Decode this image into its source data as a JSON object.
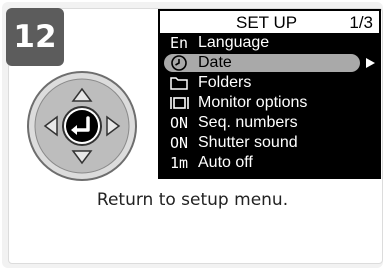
{
  "step": {
    "number": "12"
  },
  "menu": {
    "title": "SET UP",
    "page": "1/3",
    "items": [
      {
        "icon": "En",
        "label": "Language",
        "selected": false
      },
      {
        "icon": "clock",
        "label": "Date",
        "selected": true
      },
      {
        "icon": "folder",
        "label": "Folders",
        "selected": false
      },
      {
        "icon": "monitor",
        "label": "Monitor options",
        "selected": false
      },
      {
        "icon": "ON",
        "label": "Seq. numbers",
        "selected": false
      },
      {
        "icon": "ON",
        "label": "Shutter sound",
        "selected": false
      },
      {
        "icon": "1m",
        "label": "Auto off",
        "selected": false
      }
    ]
  },
  "caption": "Return to setup menu.",
  "colors": {
    "badge": "#5c5c5c",
    "highlight": "#a9a9a9",
    "menu_bg": "#000000"
  }
}
